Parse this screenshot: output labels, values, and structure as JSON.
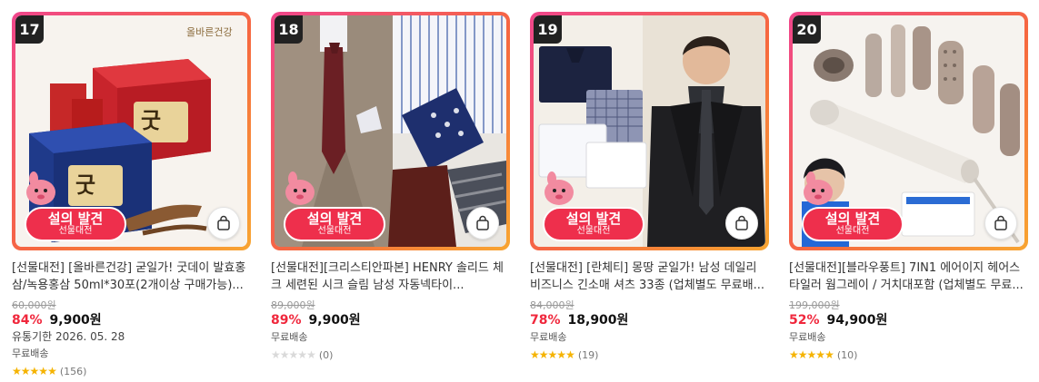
{
  "promo": {
    "main": "설의 발견",
    "sub": "선물대전"
  },
  "products": [
    {
      "rank": "17",
      "title": "[선물대전] [올바른건강] 굳일가! 굿데이 발효홍삼/녹용홍삼 50ml*30포(2개이상 구매가능)...",
      "original_price": "60,000원",
      "discount": "84%",
      "price": "9,900원",
      "expiry": "유통기한 2026. 05. 28",
      "shipping": "무료배송",
      "rating": 5,
      "review_count": "(156)",
      "image_icon": "red-ginseng-gift-box",
      "image_text": "올바른건강"
    },
    {
      "rank": "18",
      "title": "[선물대전][크리스티안파본] HENRY 솔리드 체크 세련된 시크 슬림 남성 자동넥타이...",
      "original_price": "89,000원",
      "discount": "89%",
      "price": "9,900원",
      "expiry": "",
      "shipping": "무료배송",
      "rating": 0,
      "review_count": "(0)",
      "image_icon": "necktie-collection"
    },
    {
      "rank": "19",
      "title": "[선물대전] [란체티] 몽땅 굳일가! 남성 데일리 비즈니스 긴소매 셔츠 33종 (업체별도 무료배...",
      "original_price": "84,000원",
      "discount": "78%",
      "price": "18,900원",
      "expiry": "",
      "shipping": "무료배송",
      "rating": 5,
      "review_count": "(19)",
      "image_icon": "dress-shirts-model"
    },
    {
      "rank": "20",
      "title": "[선물대전][블라우풍트] 7IN1 에어이지 헤어스타일러 웜그레이 / 거치대포함 (업체별도 무료...",
      "original_price": "199,000원",
      "discount": "52%",
      "price": "94,900원",
      "expiry": "",
      "shipping": "무료배송",
      "rating": 5,
      "review_count": "(10)",
      "image_icon": "hair-styler-set"
    }
  ],
  "colors": {
    "discount": "#f0273c",
    "star": "#f5b301",
    "frame_start": "#f0468c",
    "frame_end": "#f8a531"
  }
}
